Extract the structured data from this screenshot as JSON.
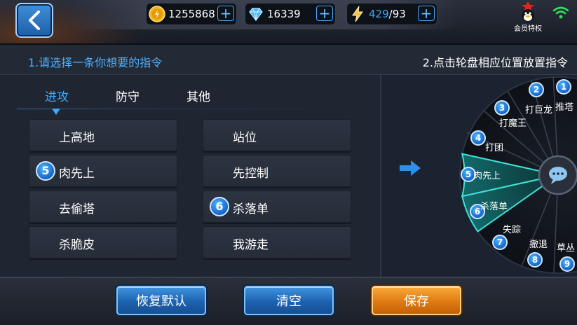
{
  "topbar": {
    "gold": "1255868",
    "diamonds": "16339",
    "energy_current": "429",
    "energy_max": "/93",
    "vip_label": "会员特权",
    "icons": [
      "back-arrow-icon",
      "gold-coin-icon",
      "diamond-icon",
      "lightning-icon",
      "plus-icon",
      "vip-mascot-icon",
      "wifi-icon"
    ]
  },
  "header": {
    "step1": "1.请选择一条你想要的指令",
    "step2": "2.点击轮盘相应位置放置指令"
  },
  "tabs": [
    {
      "label": "进攻",
      "active": true
    },
    {
      "label": "防守",
      "active": false
    },
    {
      "label": "其他",
      "active": false
    }
  ],
  "commands": [
    {
      "label": "上高地",
      "badge": ""
    },
    {
      "label": "站位",
      "badge": ""
    },
    {
      "label": "肉先上",
      "badge": "5"
    },
    {
      "label": "先控制",
      "badge": ""
    },
    {
      "label": "去偷塔",
      "badge": ""
    },
    {
      "label": "杀落单",
      "badge": "6"
    },
    {
      "label": "杀脆皮",
      "badge": ""
    },
    {
      "label": "我游走",
      "badge": ""
    }
  ],
  "wheel": {
    "slots": [
      {
        "num": "1",
        "label": "推塔"
      },
      {
        "num": "2",
        "label": "打巨龙"
      },
      {
        "num": "3",
        "label": "打魔王"
      },
      {
        "num": "4",
        "label": "打团"
      },
      {
        "num": "5",
        "label": "肉先上"
      },
      {
        "num": "6",
        "label": "杀落单"
      },
      {
        "num": "7",
        "label": "失踪"
      },
      {
        "num": "8",
        "label": "撤退"
      },
      {
        "num": "9",
        "label": "草丛"
      }
    ]
  },
  "buttons": {
    "reset": "恢复默认",
    "clear": "清空",
    "save": "保存"
  },
  "colors": {
    "accent_blue": "#3ea8ff",
    "save_orange": "#e07a12",
    "highlight_teal": "#2fd0c8"
  }
}
